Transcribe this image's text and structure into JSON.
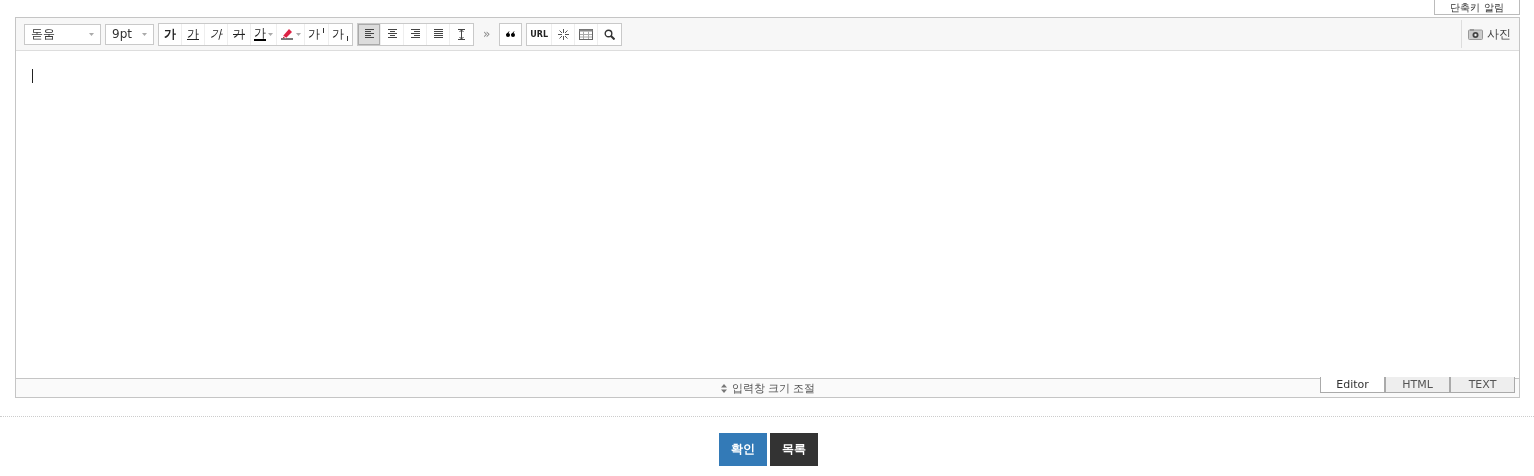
{
  "top_button": {
    "label": "단축키 알림"
  },
  "toolbar": {
    "font_select": {
      "value": "돋움"
    },
    "size_select": {
      "value": "9pt"
    },
    "format_buttons": [
      {
        "kind": "bold",
        "label": "가"
      },
      {
        "kind": "underline",
        "label": "가"
      },
      {
        "kind": "italic",
        "label": "가"
      },
      {
        "kind": "strike",
        "label": "가"
      },
      {
        "kind": "color",
        "label": "가"
      },
      {
        "kind": "highlight"
      },
      {
        "kind": "sup",
        "label": "가"
      },
      {
        "kind": "sub",
        "label": "가"
      }
    ],
    "align_buttons": [
      {
        "kind": "left",
        "selected": true
      },
      {
        "kind": "center",
        "selected": false
      },
      {
        "kind": "right",
        "selected": false
      },
      {
        "kind": "justify",
        "selected": false
      },
      {
        "kind": "lineheight",
        "selected": false
      }
    ],
    "more": "»",
    "insert_buttons": [
      {
        "kind": "quote"
      },
      {
        "kind": "url",
        "label": "URL"
      },
      {
        "kind": "special"
      },
      {
        "kind": "table"
      },
      {
        "kind": "search"
      }
    ],
    "photo_button": {
      "label": "사진"
    }
  },
  "resize_bar": {
    "label": "입력창 크기 조절"
  },
  "mode_tabs": [
    {
      "label": "Editor",
      "selected": true
    },
    {
      "label": "HTML",
      "selected": false
    },
    {
      "label": "TEXT",
      "selected": false
    }
  ],
  "actions": [
    {
      "kind": "primary",
      "label": "확인"
    },
    {
      "kind": "dark",
      "label": "목록"
    }
  ]
}
